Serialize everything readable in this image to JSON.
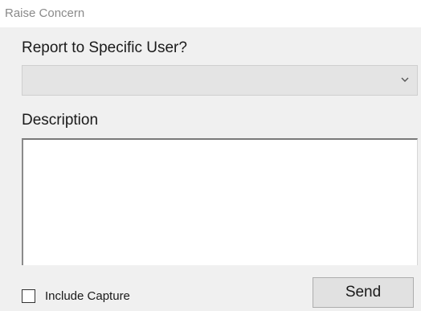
{
  "window": {
    "title": "Raise Concern"
  },
  "form": {
    "report_user_label": "Report to Specific User?",
    "report_user_value": "",
    "description_label": "Description",
    "description_value": "",
    "include_capture_label": "Include Capture",
    "include_capture_checked": false,
    "send_label": "Send"
  },
  "icons": {
    "dropdown": "chevron-down-icon"
  },
  "colors": {
    "client_background": "#f0f0f0",
    "title_text": "#8a8a8a",
    "dropdown_background": "#e4e4e4",
    "button_background": "#e1e1e1"
  }
}
